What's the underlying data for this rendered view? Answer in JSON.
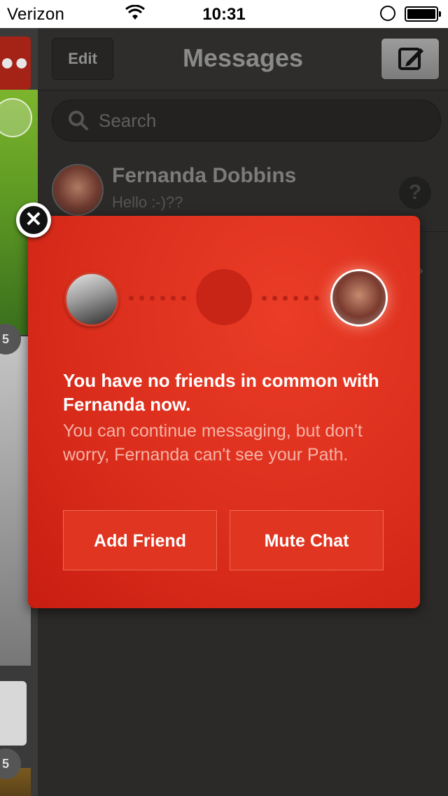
{
  "status_bar": {
    "signal_dots": "●●●○○",
    "carrier": "Verizon",
    "time": "10:31",
    "battery": "full",
    "icons": [
      "wifi-icon",
      "rotation-lock-icon",
      "battery-icon"
    ]
  },
  "header": {
    "edit_label": "Edit",
    "title": "Messages",
    "compose_icon": "compose-icon"
  },
  "search": {
    "placeholder": "Search"
  },
  "conversations": [
    {
      "name": "Fernanda Dobbins",
      "preview": "Hello :-)??",
      "status_icon": "question-icon"
    }
  ],
  "left_app": {
    "badges": [
      "5",
      "5"
    ]
  },
  "modal": {
    "heading": "You have no friends in common with Fernanda now.",
    "body": "You can continue messaging, but don't worry, Fernanda can't see your Path.",
    "add_friend_label": "Add Friend",
    "mute_chat_label": "Mute Chat",
    "close_icon": "close-icon"
  },
  "colors": {
    "modal_red": "#d92c1b",
    "button_red": "#df3521",
    "panel_dark": "#2b2a28"
  }
}
